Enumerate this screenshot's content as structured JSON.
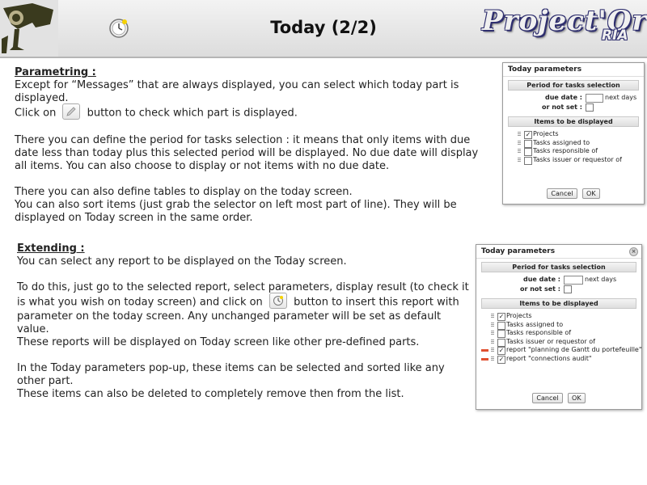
{
  "header": {
    "title": "Today (2/2)",
    "brand_main": "Project'Or",
    "brand_sub": "RIA"
  },
  "parametring": {
    "heading": "Parametring :",
    "p1": "Except for “Messages” that are always displayed, you can select which today part is displayed.",
    "p2_before": "Click on",
    "p2_after": "button to check which part is displayed.",
    "p3": "There you can define the period for tasks selection : it means that only items with due date less than today plus this selected period will be displayed. No due date will display all items. You can also choose to display or not items with no due date.",
    "p4": "There you can also define tables to display on the today screen.",
    "p5": "You can also sort items (just grab the selector on left most part of line). They will be displayed on Today screen in the same order."
  },
  "extending": {
    "heading": "Extending :",
    "p1": "You can select any report to be displayed on the Today screen.",
    "p2_before": "To do this, just go to the selected report, select parameters, display result (to check it is what you wish on today screen) and click on",
    "p2_after": "button to insert this report with parameter on the today screen. Any unchanged parameter will be set as default value.",
    "p3": "These reports will be displayed on Today screen like other pre-defined parts.",
    "p4": "In the Today parameters pop-up, these items can be selected and sorted like any other part.",
    "p5": "These items can also be deleted to completely remove then from the list."
  },
  "dialog1": {
    "title": "Today parameters",
    "period_section": "Period for tasks selection",
    "due_date_label": "due date :",
    "next_days": "next days",
    "not_set_label": "or not set :",
    "items_section": "Items to be displayed",
    "items": [
      {
        "label": "Projects",
        "checked": true
      },
      {
        "label": "Tasks assigned to",
        "checked": false
      },
      {
        "label": "Tasks responsible of",
        "checked": false
      },
      {
        "label": "Tasks issuer or requestor of",
        "checked": false
      }
    ],
    "cancel": "Cancel",
    "ok": "OK"
  },
  "dialog2": {
    "title": "Today parameters",
    "period_section": "Period for tasks selection",
    "due_date_label": "due date :",
    "next_days": "next days",
    "not_set_label": "or not set :",
    "items_section": "Items to be displayed",
    "items": [
      {
        "label": "Projects",
        "checked": true,
        "removable": false
      },
      {
        "label": "Tasks assigned to",
        "checked": false,
        "removable": false
      },
      {
        "label": "Tasks responsible of",
        "checked": false,
        "removable": false
      },
      {
        "label": "Tasks issuer or requestor of",
        "checked": false,
        "removable": false
      },
      {
        "label": "report \"planning de Gantt du portefeuille\"",
        "checked": true,
        "removable": true
      },
      {
        "label": "report \"connections audit\"",
        "checked": true,
        "removable": true
      }
    ],
    "cancel": "Cancel",
    "ok": "OK"
  },
  "colors": {
    "remove_handle": "#e05030",
    "brand_outline": "#2e2e6e"
  }
}
